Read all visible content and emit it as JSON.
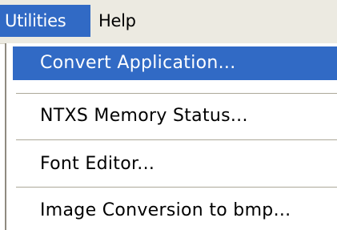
{
  "menubar": {
    "items": [
      {
        "label": "Utilities"
      },
      {
        "label": "Help"
      }
    ]
  },
  "dropdown": {
    "items": [
      {
        "label": "Convert Application..."
      },
      {
        "label": "NTXS Memory Status..."
      },
      {
        "label": "Font Editor..."
      },
      {
        "label": "Image Conversion to bmp..."
      }
    ]
  },
  "colors": {
    "highlight": "#316ac5",
    "menubar_bg": "#eceae1",
    "separator": "#aca899"
  }
}
